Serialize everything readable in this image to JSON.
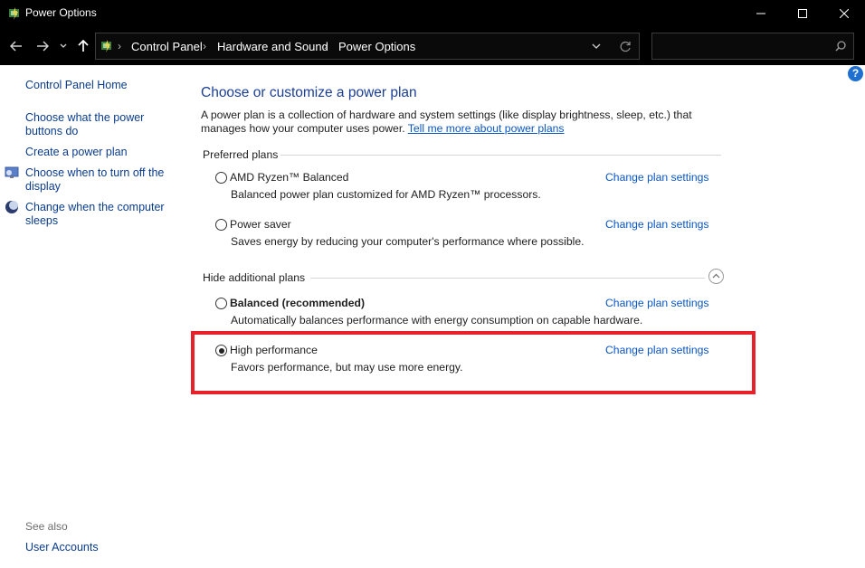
{
  "window": {
    "title": "Power Options",
    "icon": "power-options-icon",
    "controls": [
      "minimize-icon",
      "maximize-icon",
      "close-icon"
    ]
  },
  "navbar": {
    "breadcrumbs": [
      "Control Panel",
      "Hardware and Sound",
      "Power Options"
    ],
    "search_placeholder": ""
  },
  "help_label": "?",
  "sidebar": {
    "home": "Control Panel Home",
    "links": [
      {
        "label": "Choose what the power buttons do",
        "icon": null
      },
      {
        "label": "Create a power plan",
        "icon": null
      },
      {
        "label": "Choose when to turn off the display",
        "icon": "display-icon"
      },
      {
        "label": "Change when the computer sleeps",
        "icon": "sleep-icon"
      }
    ],
    "see_also": "See also",
    "see_also_links": [
      "User Accounts"
    ]
  },
  "main": {
    "heading": "Choose or customize a power plan",
    "description_text": "A power plan is a collection of hardware and system settings (like display brightness, sleep, etc.) that manages how your computer uses power. ",
    "description_link": "Tell me more about power plans",
    "preferred_label": "Preferred plans",
    "additional_label": "Hide additional plans",
    "change_label": "Change plan settings",
    "preferred_plans": [
      {
        "name": "AMD Ryzen™ Balanced",
        "description": "Balanced power plan customized for AMD Ryzen™ processors.",
        "selected": false,
        "bold": false
      },
      {
        "name": "Power saver",
        "description": "Saves energy by reducing your computer's performance where possible.",
        "selected": false,
        "bold": false
      }
    ],
    "additional_plans": [
      {
        "name": "Balanced (recommended)",
        "description": "Automatically balances performance with energy consumption on capable hardware.",
        "selected": false,
        "bold": true
      },
      {
        "name": "High performance",
        "description": "Favors performance, but may use more energy.",
        "selected": true,
        "bold": false
      }
    ]
  },
  "colors": {
    "highlight_border": "#e8202a",
    "link": "#0a56c4",
    "heading": "#1b3e95",
    "titlebar": "#000000"
  }
}
